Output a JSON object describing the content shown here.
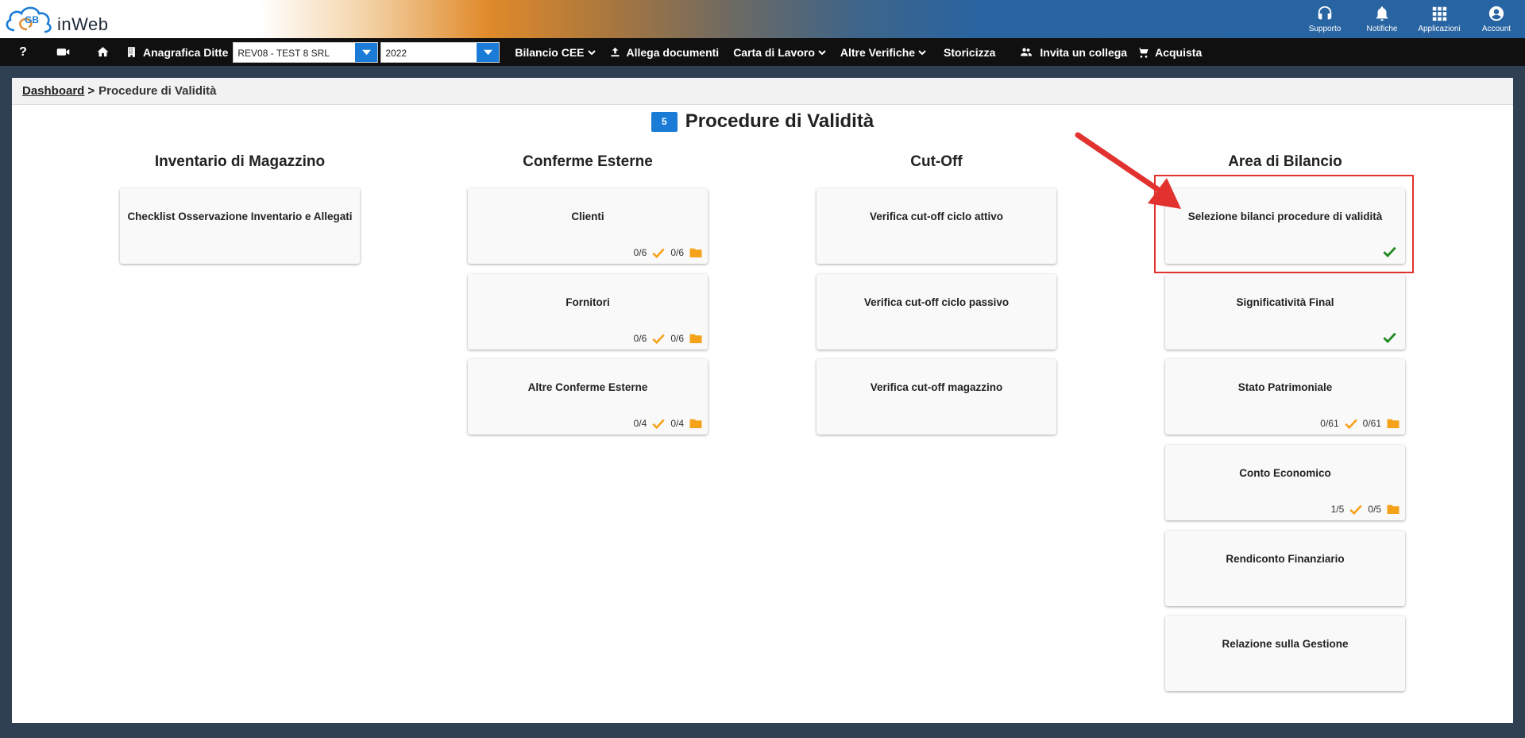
{
  "app": {
    "logo_text": "inWeb",
    "logo_mark": "GB"
  },
  "top_actions": [
    {
      "label": "Supporto",
      "icon": "headset-icon"
    },
    {
      "label": "Notifiche",
      "icon": "bell-icon"
    },
    {
      "label": "Applicazioni",
      "icon": "apps-grid-icon"
    },
    {
      "label": "Account",
      "icon": "user-circle-icon"
    }
  ],
  "nav": {
    "help": "?",
    "anagrafica_label": "Anagrafica Ditte",
    "company_value": "REV08 - TEST 8 SRL",
    "year_value": "2022",
    "bilancio_label": "Bilancio CEE",
    "allega_label": "Allega documenti",
    "carta_label": "Carta di Lavoro",
    "altre_label": "Altre Verifiche",
    "storicizza_label": "Storicizza",
    "invita_label": "Invita un collega",
    "acquista_label": "Acquista"
  },
  "breadcrumb": {
    "home": "Dashboard",
    "separator": ">",
    "current": "Procedure di Validità"
  },
  "page": {
    "badge": "5",
    "title": "Procedure di Validità"
  },
  "columns": [
    {
      "heading": "Inventario di Magazzino",
      "cards": [
        {
          "title": "Checklist Osservazione Inventario e Allegati"
        }
      ]
    },
    {
      "heading": "Conferme Esterne",
      "cards": [
        {
          "title": "Clienti",
          "checked": "0/6",
          "files": "0/6"
        },
        {
          "title": "Fornitori",
          "checked": "0/6",
          "files": "0/6"
        },
        {
          "title": "Altre Conferme Esterne",
          "checked": "0/4",
          "files": "0/4"
        }
      ]
    },
    {
      "heading": "Cut-Off",
      "cards": [
        {
          "title": "Verifica cut-off ciclo attivo"
        },
        {
          "title": "Verifica cut-off ciclo passivo"
        },
        {
          "title": "Verifica cut-off magazzino"
        }
      ]
    },
    {
      "heading": "Area di Bilancio",
      "cards": [
        {
          "title": "Selezione bilanci procedure di validità",
          "done": true
        },
        {
          "title": "Significatività Final",
          "done": true
        },
        {
          "title": "Stato Patrimoniale",
          "checked": "0/61",
          "files": "0/61"
        },
        {
          "title": "Conto Economico",
          "checked": "1/5",
          "files": "0/5"
        },
        {
          "title": "Rendiconto Finanziario"
        },
        {
          "title": "Relazione sulla Gestione"
        }
      ]
    }
  ],
  "colors": {
    "accent_blue": "#1a7cd6",
    "check_orange": "#f5a21b",
    "folder_orange": "#f5a21b",
    "done_green": "#1e8a1e",
    "highlight_red": "#e1322f"
  }
}
